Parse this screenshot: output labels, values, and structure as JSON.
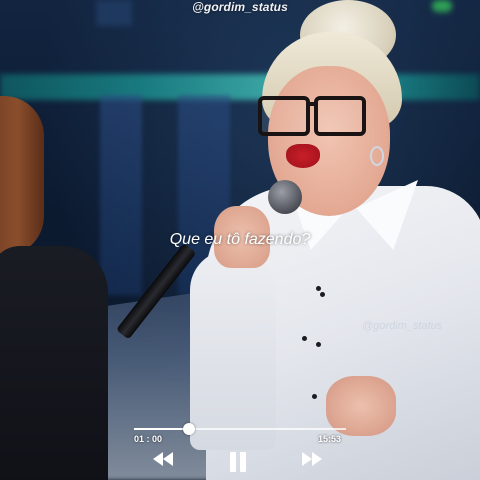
{
  "overlay": {
    "watermark_top": "@gordim_status",
    "watermark_mid": "@gordim_status",
    "subtitle": "Que eu tô fazendo?"
  },
  "player": {
    "current_time": "01 : 00",
    "total_time": "15:53",
    "progress_percent": 26,
    "controls": {
      "rewind_icon": "rewind-icon",
      "pause_icon": "pause-icon",
      "forward_icon": "fast-forward-icon"
    },
    "colors": {
      "track": "#ffffff",
      "knob": "#ffffff"
    }
  }
}
